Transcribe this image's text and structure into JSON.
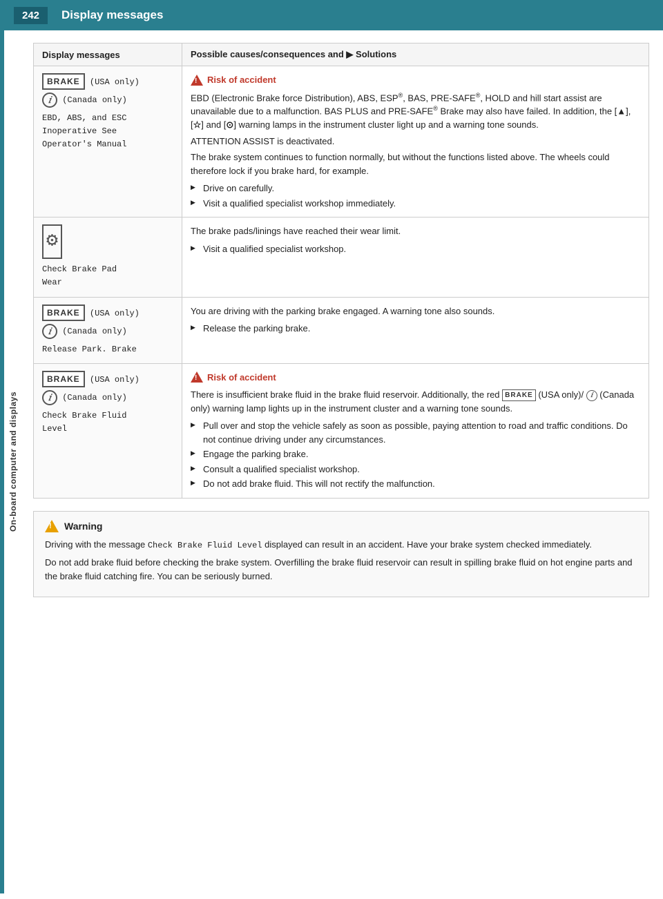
{
  "header": {
    "page_number": "242",
    "title": "Display messages"
  },
  "sidebar": {
    "label": "On-board computer and displays"
  },
  "table": {
    "col1_header": "Display messages",
    "col2_header": "Possible causes/consequences and ▶ Solutions",
    "rows": [
      {
        "id": "row-ebd",
        "display_msg_lines": [
          "BRAKE (USA only)",
          "(Canada only)",
          "EBD, ABS, and ESC",
          "Inoperative See",
          "Operator's Manual"
        ],
        "risk_label": "Risk of accident",
        "content": "EBD (Electronic Brake force Distribution), ABS, ESP®, BAS, PRE-SAFE®, HOLD and hill start assist are unavailable due to a malfunction. BAS PLUS and PRE-SAFE® Brake may also have failed. In addition, the [▲], [☆] and [⊙] warning lamps in the instrument cluster light up and a warning tone sounds.",
        "attention": "ATTENTION ASSIST is deactivated.",
        "normal": "The brake system continues to function normally, but without the functions listed above. The wheels could therefore lock if you brake hard, for example.",
        "bullets": [
          "Drive on carefully.",
          "Visit a qualified specialist workshop immediately."
        ]
      },
      {
        "id": "row-brake-pad",
        "icon_label": "⚙",
        "display_msg_lines": [
          "Check Brake Pad",
          "Wear"
        ],
        "content": "The brake pads/linings have reached their wear limit.",
        "bullets": [
          "Visit a qualified specialist workshop."
        ]
      },
      {
        "id": "row-release-park",
        "display_msg_lines": [
          "BRAKE (USA only)",
          "(Canada only)",
          "Release Park. Brake"
        ],
        "content": "You are driving with the parking brake engaged. A warning tone also sounds.",
        "bullets": [
          "Release the parking brake."
        ]
      },
      {
        "id": "row-check-fluid",
        "display_msg_lines": [
          "BRAKE (USA only)",
          "(Canada only)",
          "Check Brake Fluid",
          "Level"
        ],
        "risk_label": "Risk of accident",
        "content_main": "There is insufficient brake fluid in the brake fluid reservoir. Additionally, the red BRAKE (USA only)/ [⊙] (Canada only) warning lamp lights up in the instrument cluster and a warning tone sounds.",
        "bullets": [
          "Pull over and stop the vehicle safely as soon as possible, paying attention to road and traffic conditions. Do not continue driving under any circumstances.",
          "Engage the parking brake.",
          "Consult a qualified specialist workshop.",
          "Do not add brake fluid. This will not rectify the malfunction."
        ]
      }
    ]
  },
  "warning_box": {
    "title": "Warning",
    "para1": "Driving with the message Check Brake Fluid Level displayed can result in an accident. Have your brake system checked immediately.",
    "para2": "Do not add brake fluid before checking the brake system. Overfilling the brake fluid reservoir can result in spilling brake fluid on hot engine parts and the brake fluid catching fire. You can be seriously burned."
  }
}
